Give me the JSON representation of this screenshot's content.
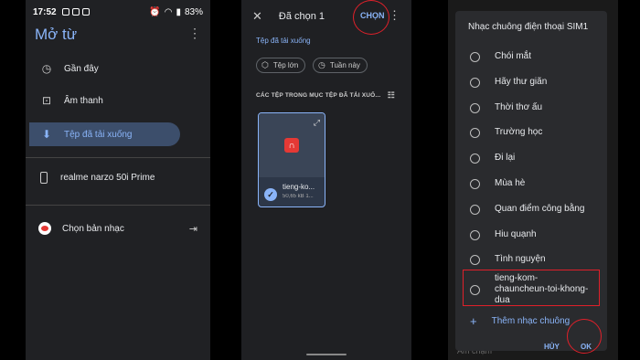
{
  "panel1": {
    "status": {
      "time": "17:52",
      "battery": "83%"
    },
    "title": "Mở từ",
    "nav": [
      {
        "label": "Gần đây",
        "icon": "clock-icon"
      },
      {
        "label": "Âm thanh",
        "icon": "audio-icon"
      },
      {
        "label": "Tệp đã tải xuống",
        "icon": "download-icon",
        "active": true
      }
    ],
    "device": "realme narzo 50i Prime",
    "app": "Chọn bản nhạc"
  },
  "panel2": {
    "title": "Đã chọn 1",
    "select_button": "CHỌN",
    "subtitle": "Tệp đã tải xuống",
    "chips": [
      "Tệp lớn",
      "Tuần này"
    ],
    "section": "CÁC TỆP TRONG MỤC TỆP ĐÃ TẢI XUỐ...",
    "file": {
      "name": "tieng-ko...",
      "size": "50,65 kB 1..."
    }
  },
  "panel3": {
    "title": "Nhạc chuông điện thoại SIM1",
    "ringtones": [
      "Chói mắt",
      "Hãy thư giãn",
      "Thời thơ ấu",
      "Trường học",
      "Đi lại",
      "Mùa hè",
      "Quan điểm công bằng",
      "Hiu quạnh",
      "Tình nguyện",
      "tieng-kom-chauncheun-toi-khong-dua"
    ],
    "add_label": "Thêm nhạc chuông",
    "cancel": "HỦY",
    "ok": "OK",
    "behind_text": "Âm chạm"
  },
  "colors": {
    "accent": "#8ab4f8",
    "highlight": "#e0202a"
  }
}
